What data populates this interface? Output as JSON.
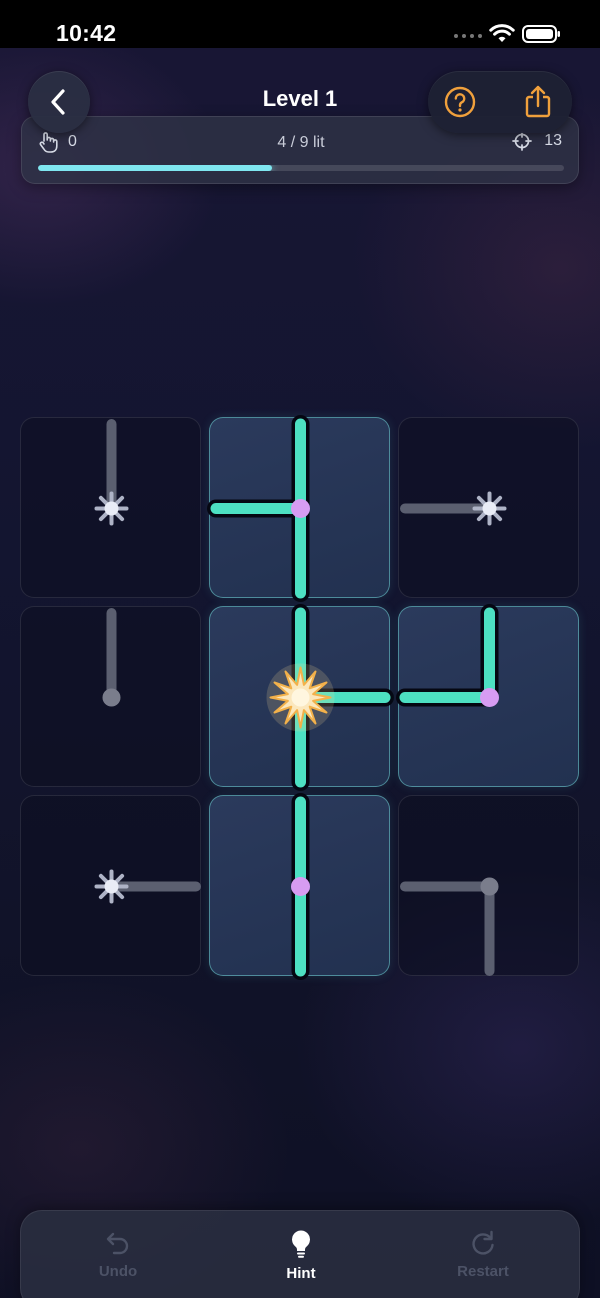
{
  "status_bar": {
    "time": "10:42"
  },
  "header": {
    "title": "Level 1"
  },
  "progress": {
    "taps": "0",
    "lit_text": "4 / 9 lit",
    "target": "13",
    "fraction": 0.445
  },
  "board": {
    "rows": 3,
    "cols": 3,
    "tiles": [
      {
        "row": 0,
        "col": 0,
        "lit": false,
        "arms": [
          "up"
        ],
        "center": "spark"
      },
      {
        "row": 0,
        "col": 1,
        "lit": true,
        "arms": [
          "up",
          "down",
          "left"
        ],
        "center": "node"
      },
      {
        "row": 0,
        "col": 2,
        "lit": false,
        "arms": [
          "left"
        ],
        "center": "spark"
      },
      {
        "row": 1,
        "col": 0,
        "lit": false,
        "arms": [
          "up"
        ],
        "center": "dot"
      },
      {
        "row": 1,
        "col": 1,
        "lit": true,
        "arms": [
          "up",
          "down",
          "right"
        ],
        "center": "source"
      },
      {
        "row": 1,
        "col": 2,
        "lit": true,
        "arms": [
          "up",
          "left"
        ],
        "center": "node"
      },
      {
        "row": 2,
        "col": 0,
        "lit": false,
        "arms": [
          "right"
        ],
        "center": "spark"
      },
      {
        "row": 2,
        "col": 1,
        "lit": true,
        "arms": [
          "up",
          "down"
        ],
        "center": "node"
      },
      {
        "row": 2,
        "col": 2,
        "lit": false,
        "arms": [
          "left",
          "down"
        ],
        "center": "dot"
      }
    ]
  },
  "toolbar": {
    "undo_label": "Undo",
    "hint_label": "Hint",
    "restart_label": "Restart"
  },
  "colors": {
    "lit_pipe": "#4de0c2",
    "unlit_pipe": "#5b5f70",
    "node": "#d79cf2",
    "accent_orange": "#f0a03c",
    "progress_fill": "#7fe6f0"
  }
}
